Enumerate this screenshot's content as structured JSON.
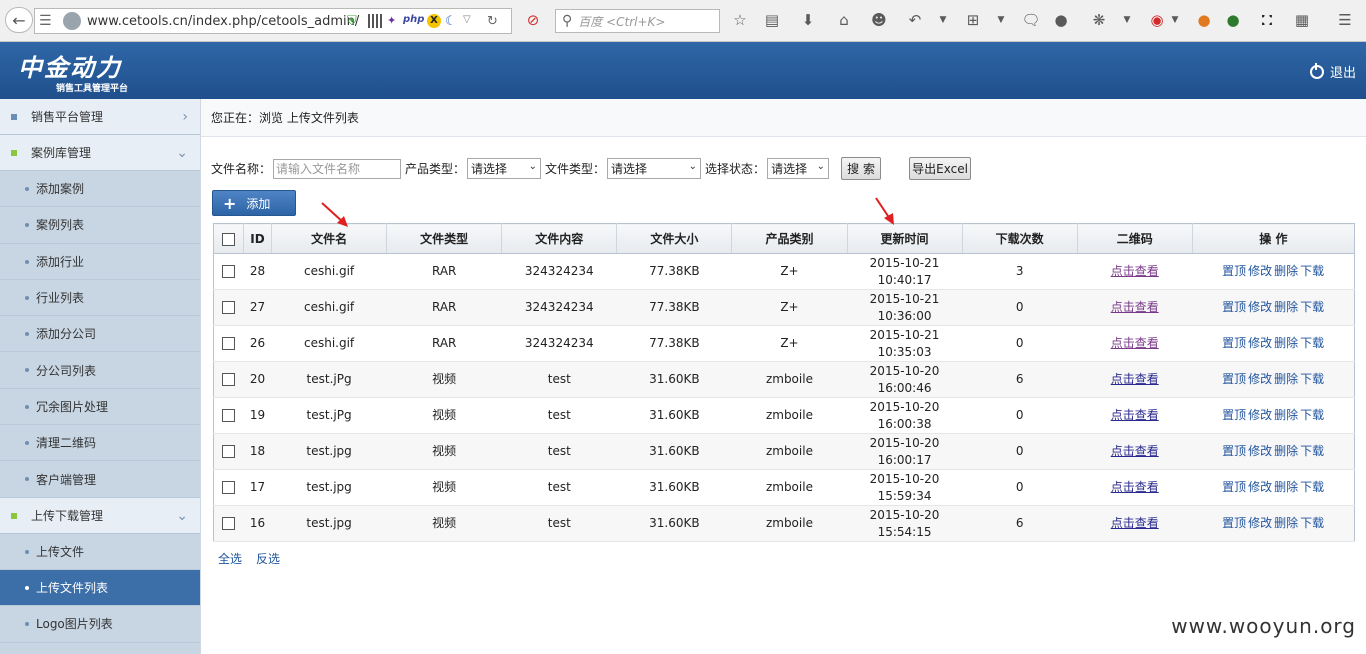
{
  "browser": {
    "url": "www.cetools.cn/index.php/cetools_admin/",
    "search_placeholder": "百度 <Ctrl+K>"
  },
  "header": {
    "logo_text": "中金动力",
    "logo_subtitle": "销售工具管理平台",
    "logout_label": "退出"
  },
  "sidebar": {
    "groups": [
      {
        "label": "销售平台管理",
        "bullet_color": "#6a8fb6",
        "chevron": "›"
      },
      {
        "label": "案例库管理",
        "bullet_color": "#8cc63f",
        "chevron": "⌄"
      },
      {
        "label": "上传下载管理",
        "bullet_color": "#8cc63f",
        "chevron": "⌄"
      }
    ],
    "case_items": [
      "添加案例",
      "案例列表",
      "添加行业",
      "行业列表",
      "添加分公司",
      "分公司列表",
      "冗余图片处理",
      "清理二维码",
      "客户端管理"
    ],
    "upload_items": [
      "上传文件",
      "上传文件列表",
      "Logo图片列表"
    ]
  },
  "breadcrumb": "您正在：浏览 上传文件列表",
  "filters": {
    "filename_label": "文件名称：",
    "filename_placeholder": "请输入文件名称",
    "product_type_label": "产品类型：",
    "product_type_value": "请选择",
    "file_type_label": "文件类型：",
    "file_type_value": "请选择",
    "status_label": "选择状态：",
    "status_value": "请选择",
    "search_label": "搜 索",
    "export_label": "导出Excel"
  },
  "add_label": "添加",
  "table": {
    "headers": [
      "ID",
      "文件名",
      "文件类型",
      "文件内容",
      "文件大小",
      "产品类别",
      "更新时间",
      "下载次数",
      "二维码",
      "操 作"
    ],
    "rows": [
      {
        "id": "28",
        "name": "ceshi.gif",
        "type": "RAR",
        "content": "324324234",
        "size": "77.38KB",
        "category": "Z+",
        "date": "2015-10-21",
        "time": "10:40:17",
        "downloads": "3",
        "qr": "点击查看"
      },
      {
        "id": "27",
        "name": "ceshi.gif",
        "type": "RAR",
        "content": "324324234",
        "size": "77.38KB",
        "category": "Z+",
        "date": "2015-10-21",
        "time": "10:36:00",
        "downloads": "0",
        "qr": "点击查看"
      },
      {
        "id": "26",
        "name": "ceshi.gif",
        "type": "RAR",
        "content": "324324234",
        "size": "77.38KB",
        "category": "Z+",
        "date": "2015-10-21",
        "time": "10:35:03",
        "downloads": "0",
        "qr": "点击查看"
      },
      {
        "id": "20",
        "name": "test.jPg",
        "type": "视频",
        "content": "test",
        "size": "31.60KB",
        "category": "zmboile",
        "date": "2015-10-20",
        "time": "16:00:46",
        "downloads": "6",
        "qr": "点击查看"
      },
      {
        "id": "19",
        "name": "test.jPg",
        "type": "视频",
        "content": "test",
        "size": "31.60KB",
        "category": "zmboile",
        "date": "2015-10-20",
        "time": "16:00:38",
        "downloads": "0",
        "qr": "点击查看"
      },
      {
        "id": "18",
        "name": "test.jpg",
        "type": "视频",
        "content": "test",
        "size": "31.60KB",
        "category": "zmboile",
        "date": "2015-10-20",
        "time": "16:00:17",
        "downloads": "0",
        "qr": "点击查看"
      },
      {
        "id": "17",
        "name": "test.jpg",
        "type": "视频",
        "content": "test",
        "size": "31.60KB",
        "category": "zmboile",
        "date": "2015-10-20",
        "time": "15:59:34",
        "downloads": "0",
        "qr": "点击查看"
      },
      {
        "id": "16",
        "name": "test.jpg",
        "type": "视频",
        "content": "test",
        "size": "31.60KB",
        "category": "zmboile",
        "date": "2015-10-20",
        "time": "15:54:15",
        "downloads": "6",
        "qr": "点击查看"
      }
    ],
    "actions": [
      "置顶",
      "修改",
      "删除",
      "下载"
    ]
  },
  "select_all_label": "全选",
  "invert_label": "反选",
  "watermark": "www.wooyun.org",
  "colors": {
    "header": "#2a5d9b",
    "sidebar_active": "#3c6ea8",
    "annotation_arrow": "#e02020"
  }
}
